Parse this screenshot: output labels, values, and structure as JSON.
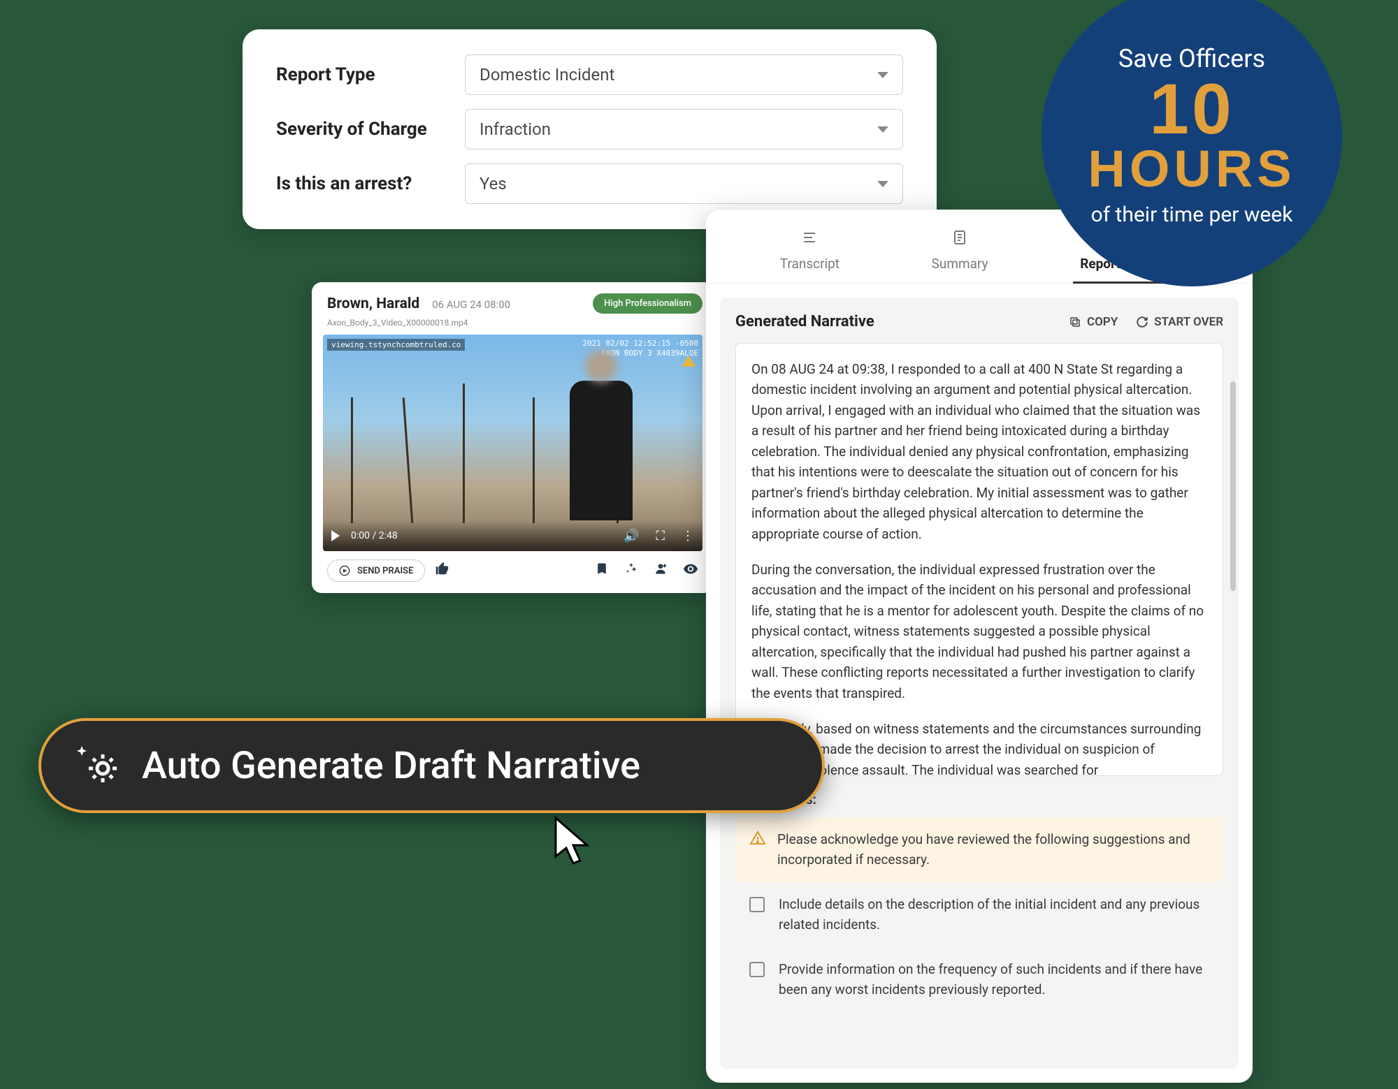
{
  "form": {
    "fields": [
      {
        "label": "Report Type",
        "value": "Domestic Incident"
      },
      {
        "label": "Severity of Charge",
        "value": "Infraction"
      },
      {
        "label": "Is this an arrest?",
        "value": "Yes"
      }
    ]
  },
  "badge": {
    "line1": "Save Officers",
    "big1": "10",
    "big2": "HOURS",
    "line2": "of their time per week"
  },
  "video": {
    "name": "Brown, Harald",
    "date": "06 AUG 24 08:00",
    "filename": "Axon_Body_3_Video_X00000018.mp4",
    "overlayLeft": "viewing.tstynchcombtruled.co",
    "overlayRight1": "2021 02/02 12:52:15 -0500",
    "overlayRight2": "AXON BODY 3 X4039ALQE",
    "pill": "High Professionalism",
    "time": "0:00 / 2:48",
    "sendPraise": "SEND PRAISE"
  },
  "tabs": {
    "transcript": "Transcript",
    "summary": "Summary",
    "report": "Report Narrative"
  },
  "narrative": {
    "title": "Generated Narrative",
    "copy": "COPY",
    "startOver": "START OVER",
    "p1": "On 08 AUG 24 at 09:38, I responded to a call at 400 N State St regarding a domestic incident involving an argument and potential physical altercation. Upon arrival, I engaged with an individual who claimed that the situation was a result of his partner and her friend being intoxicated during a birthday celebration. The individual denied any physical confrontation, emphasizing that his intentions were to deescalate the situation out of concern for his partner's friend's birthday celebration. My initial assessment was to gather information about the alleged physical altercation to determine the appropriate course of action.",
    "p2": "During the conversation, the individual expressed frustration over the accusation and the impact of the incident on his personal and professional life, stating that he is a mentor for adolescent youth. Despite the claims of no physical contact, witness statements suggested a possible physical altercation, specifically that the individual had pushed his partner against a wall. These conflicting reports necessitated a further investigation to clarify the events that transpired.",
    "p3": "Ultimately, based on witness statements and the circumstances surrounding the event, I made the decision to arrest the individual on suspicion of domestic violence assault. The individual was searched for"
  },
  "suggestions": {
    "label": "Suggestions:",
    "ack": "Please acknowledge you have reviewed the following suggestions and incorporated if necessary.",
    "items": [
      "Include details on the description of the initial incident and any previous related incidents.",
      "Provide information on the frequency of such incidents and if there have been any worst incidents previously reported."
    ]
  },
  "autoGen": {
    "label": "Auto Generate Draft Narrative"
  }
}
